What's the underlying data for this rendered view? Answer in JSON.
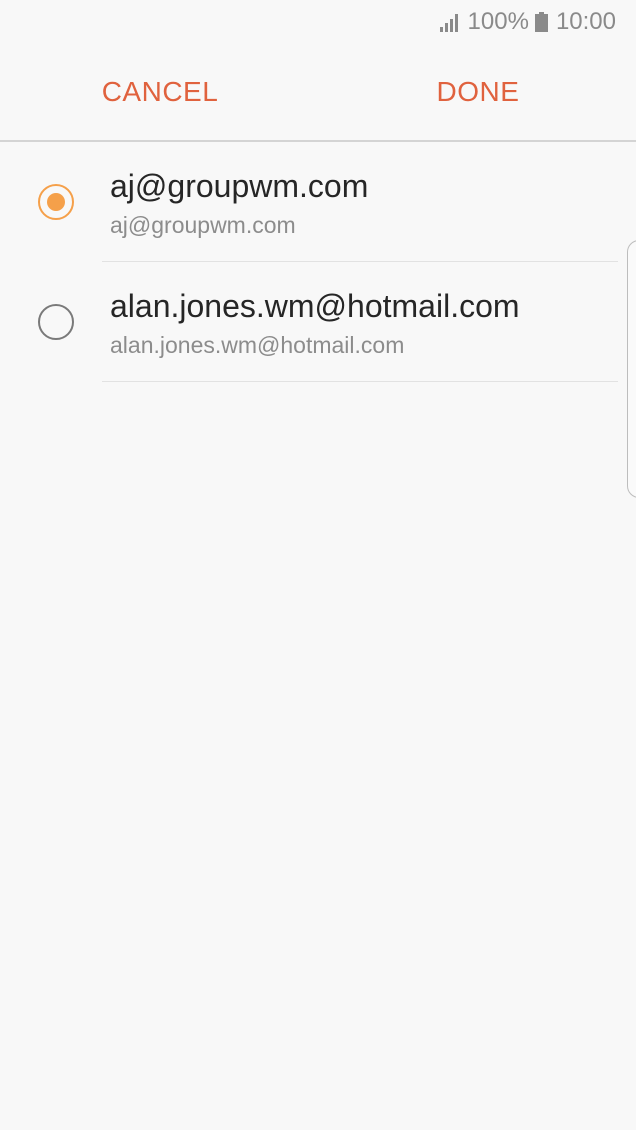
{
  "status_bar": {
    "battery_percent": "100%",
    "time": "10:00",
    "signal_icon": "signal-icon",
    "battery_icon": "battery-icon"
  },
  "action_bar": {
    "cancel_label": "CANCEL",
    "done_label": "DONE",
    "accent_color": "#e0623e"
  },
  "accounts": [
    {
      "name": "aj@groupwm.com",
      "sub": "aj@groupwm.com",
      "selected": true
    },
    {
      "name": "alan.jones.wm@hotmail.com",
      "sub": "alan.jones.wm@hotmail.com",
      "selected": false
    }
  ],
  "colors": {
    "radio_selected": "#f5a04a",
    "background": "#f8f8f8"
  }
}
